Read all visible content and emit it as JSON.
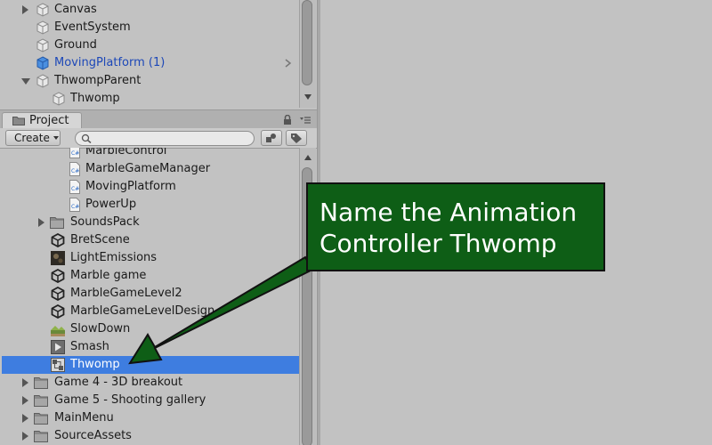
{
  "hierarchy": {
    "items": [
      {
        "label": "Canvas"
      },
      {
        "label": "EventSystem"
      },
      {
        "label": "Ground"
      },
      {
        "label": "MovingPlatform (1)"
      },
      {
        "label": "ThwompParent"
      },
      {
        "label": "Thwomp"
      }
    ]
  },
  "project_panel": {
    "tab_label": "Project",
    "create_label": "Create",
    "search": {
      "placeholder": "",
      "value": ""
    },
    "items": [
      {
        "label": "MarbleControl",
        "icon": "csharp-script-icon"
      },
      {
        "label": "MarbleGameManager",
        "icon": "csharp-script-icon"
      },
      {
        "label": "MovingPlatform",
        "icon": "csharp-script-icon"
      },
      {
        "label": "PowerUp",
        "icon": "csharp-script-icon"
      },
      {
        "label": "SoundsPack",
        "icon": "folder-icon"
      },
      {
        "label": "BretScene",
        "icon": "unity-scene-icon"
      },
      {
        "label": "LightEmissions",
        "icon": "lighting-data-icon"
      },
      {
        "label": "Marble game",
        "icon": "unity-scene-icon"
      },
      {
        "label": "MarbleGameLevel2",
        "icon": "unity-scene-icon"
      },
      {
        "label": "MarbleGameLevelDesign",
        "icon": "unity-scene-icon"
      },
      {
        "label": "SlowDown",
        "icon": "terrain-asset-icon"
      },
      {
        "label": "Smash",
        "icon": "animation-clip-icon"
      },
      {
        "label": "Thwomp",
        "icon": "animator-controller-icon"
      },
      {
        "label": "Game 4 - 3D breakout",
        "icon": "folder-icon"
      },
      {
        "label": "Game 5 - Shooting gallery",
        "icon": "folder-icon"
      },
      {
        "label": "MainMenu",
        "icon": "folder-icon"
      },
      {
        "label": "SourceAssets",
        "icon": "folder-icon"
      }
    ]
  },
  "callout": {
    "text": "Name the Animation Controller Thwomp",
    "background": "#0e5e16",
    "arrow_color": "#0e5e16"
  },
  "colors": {
    "selection": "#3e7de0",
    "active_prefab_text": "#1d48b8"
  }
}
